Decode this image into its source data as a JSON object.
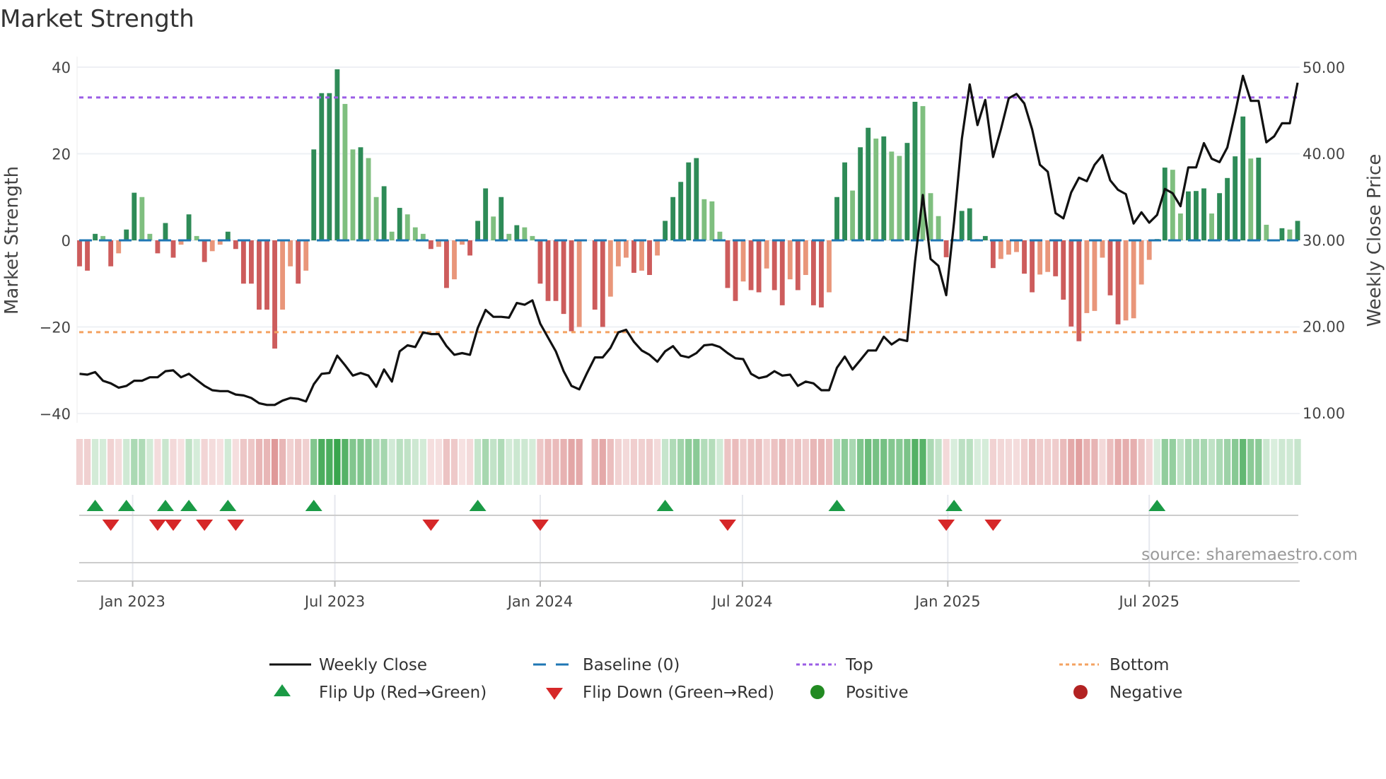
{
  "chart_data": {
    "type": "bar",
    "title": "Market Strength",
    "ylabel": "Market Strength",
    "y2label": "Weekly Close Price",
    "ylim": [
      -42,
      42
    ],
    "y2lim": [
      10,
      50
    ],
    "y_ticks": [
      "40",
      "20",
      "0",
      "−20",
      "−40"
    ],
    "y_tick_values": [
      40,
      20,
      0,
      -20,
      -40
    ],
    "y2_ticks": [
      "50.00",
      "40.00",
      "30.00",
      "20.00",
      "10.00"
    ],
    "y2_tick_values": [
      50,
      40,
      30,
      20,
      10
    ],
    "x_ticks": [
      {
        "label": "Jan 2023",
        "week": 6.8
      },
      {
        "label": "Jul 2023",
        "week": 32.7
      },
      {
        "label": "Jan 2024",
        "week": 59.0
      },
      {
        "label": "Jul 2024",
        "week": 84.9
      },
      {
        "label": "Jan 2025",
        "week": 111.2
      },
      {
        "label": "Jul 2025",
        "week": 137.0
      }
    ],
    "top_level": 33.0,
    "bottom_level": -21.2,
    "baseline": 0,
    "series": [
      {
        "name": "Market Strength",
        "values": [
          -6,
          -7,
          1.5,
          1,
          -6,
          -3,
          2.5,
          11,
          10,
          1.5,
          -3,
          4,
          -4,
          -1,
          6,
          1,
          -5,
          -2.5,
          -1,
          2,
          -2,
          -10,
          -10,
          -16,
          -16,
          -25,
          -16,
          -6,
          -10,
          -7,
          21,
          34,
          34,
          39.5,
          31.5,
          21,
          21.5,
          19,
          10,
          12.5,
          2,
          7.5,
          6,
          3,
          1.5,
          -2,
          -1.5,
          -11,
          -9,
          -1,
          -3.5,
          4.5,
          12,
          5.5,
          10,
          1.5,
          3.5,
          3,
          1,
          -10,
          -14,
          -14,
          -17,
          -21,
          -20,
          0,
          -16,
          -20,
          -13,
          -6,
          -4,
          -7.5,
          -7,
          -8,
          -3.5,
          4.5,
          10,
          13.5,
          18,
          19,
          9.5,
          9,
          2,
          -11,
          -14,
          -9.5,
          -11.5,
          -12,
          -6.5,
          -11.5,
          -15,
          -9,
          -11.5,
          -8,
          -15,
          -15.5,
          -12,
          10,
          18,
          11.5,
          21.5,
          26,
          23.5,
          24,
          20.5,
          19.5,
          22.5,
          32,
          31,
          10.9,
          5.6,
          -3.9,
          0.3,
          6.8,
          7.4,
          0.3,
          1.0,
          -6.4,
          -4.3,
          -3.3,
          -2.7,
          -7.7,
          -12.0,
          -7.9,
          -7.3,
          -8.3,
          -13.7,
          -19.9,
          -23.3,
          -16.8,
          -16.3,
          -4.0,
          -12.7,
          -19.4,
          -18.5,
          -18.0,
          -10.2,
          -4.5,
          0.3,
          16.8,
          16.3,
          6.2,
          11.3,
          11.4,
          12.0,
          6.2,
          10.9,
          14.4,
          19.4,
          28.6,
          18.9,
          19.1,
          3.6,
          0.2,
          2.8,
          2.5,
          4.5
        ]
      },
      {
        "name": "Weekly Close",
        "values": [
          14.5,
          14.4,
          14.7,
          13.7,
          13.4,
          12.9,
          13.1,
          13.7,
          13.7,
          14.1,
          14.1,
          14.8,
          14.9,
          14.1,
          14.5,
          13.8,
          13.1,
          12.6,
          12.5,
          12.5,
          12.1,
          12.0,
          11.7,
          11.1,
          10.9,
          10.9,
          11.4,
          11.7,
          11.6,
          11.3,
          13.3,
          14.5,
          14.6,
          16.6,
          15.5,
          14.3,
          14.6,
          14.3,
          13.0,
          15.0,
          13.6,
          17.1,
          17.8,
          17.6,
          19.3,
          19.1,
          19.1,
          17.7,
          16.7,
          16.9,
          16.7,
          19.8,
          21.9,
          21.1,
          21.1,
          21.0,
          22.7,
          22.5,
          23.0,
          20.3,
          18.7,
          17.1,
          14.8,
          13.1,
          12.7,
          14.6,
          16.4,
          16.4,
          17.5,
          19.3,
          19.6,
          18.2,
          17.2,
          16.7,
          15.9,
          17.1,
          17.7,
          16.6,
          16.4,
          16.9,
          17.8,
          17.9,
          17.6,
          16.9,
          16.3,
          16.2,
          14.5,
          14.0,
          14.2,
          14.8,
          14.3,
          14.4,
          13.1,
          13.6,
          13.4,
          12.6,
          12.6,
          15.2,
          16.5,
          15.0,
          16.1,
          17.2,
          17.2,
          18.8,
          17.9,
          18.5,
          18.3,
          27.5,
          35.2,
          27.8,
          27.0,
          23.6,
          32.1,
          41.7,
          48.0,
          43.3,
          46.2,
          39.6,
          42.8,
          46.4,
          46.9,
          45.8,
          42.8,
          38.7,
          37.9,
          33.1,
          32.5,
          35.5,
          37.2,
          36.8,
          38.7,
          39.8,
          36.9,
          35.8,
          35.3,
          31.9,
          33.2,
          32.0,
          32.9,
          35.9,
          35.4,
          33.9,
          38.4,
          38.4,
          41.2,
          39.4,
          39.0,
          40.7,
          44.7,
          49.0,
          46.1,
          46.1,
          41.3,
          42.0,
          43.5,
          43.5,
          48.2
        ]
      }
    ],
    "legend": {
      "position": "bottom",
      "items": [
        {
          "label": "Weekly Close",
          "symbol": "line",
          "color": "#111111"
        },
        {
          "label": "Baseline (0)",
          "symbol": "dash",
          "color": "#1f77b4"
        },
        {
          "label": "Top",
          "symbol": "dot",
          "color": "#9b5de5"
        },
        {
          "label": "Bottom",
          "symbol": "dot",
          "color": "#f4a261"
        },
        {
          "label": "Flip Up (Red→Green)",
          "symbol": "triangle-up",
          "color": "#1a9a45"
        },
        {
          "label": "Flip Down (Green→Red)",
          "symbol": "triangle-down",
          "color": "#d62728"
        },
        {
          "label": "Positive",
          "symbol": "circle",
          "color": "#228b22"
        },
        {
          "label": "Negative",
          "symbol": "circle",
          "color": "#b22222"
        }
      ]
    },
    "colors": {
      "pos_strong": "#2e8b57",
      "pos_weak": "#7fbf7f",
      "neg_strong": "#cd5c5c",
      "neg_weak": "#e9967a",
      "baseline": "#1f77b4",
      "top": "#9b5de5",
      "bottom": "#f4a261",
      "line": "#111111",
      "flip_up": "#1a9a45",
      "flip_down": "#d62728"
    },
    "source": "source: sharemaestro.com"
  }
}
